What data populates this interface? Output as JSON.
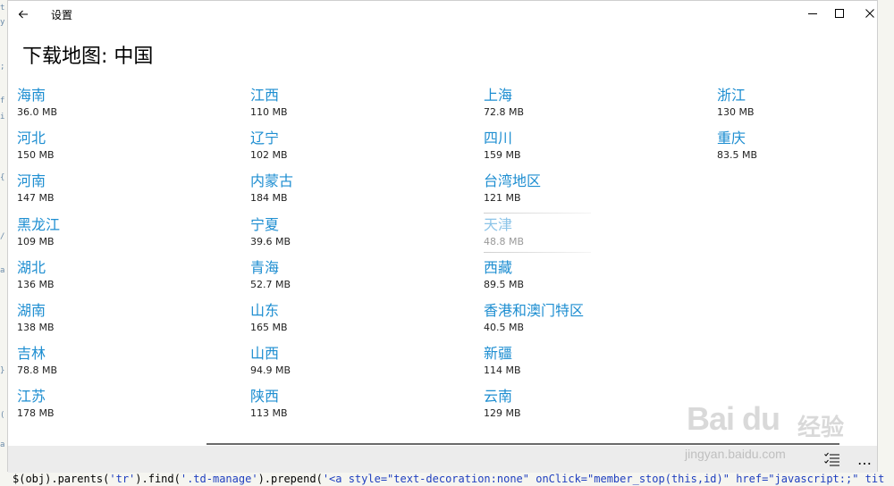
{
  "window": {
    "title": "设置"
  },
  "page": {
    "title": "下载地图: 中国"
  },
  "columns": [
    [
      {
        "name": "海南",
        "size": "36.0 MB"
      },
      {
        "name": "河北",
        "size": "150 MB"
      },
      {
        "name": "河南",
        "size": "147 MB"
      },
      {
        "name": "黑龙江",
        "size": "109 MB"
      },
      {
        "name": "湖北",
        "size": "136 MB"
      },
      {
        "name": "湖南",
        "size": "138 MB"
      },
      {
        "name": "吉林",
        "size": "78.8 MB"
      },
      {
        "name": "江苏",
        "size": "178 MB"
      }
    ],
    [
      {
        "name": "江西",
        "size": "110 MB"
      },
      {
        "name": "辽宁",
        "size": "102 MB"
      },
      {
        "name": "内蒙古",
        "size": "184 MB"
      },
      {
        "name": "宁夏",
        "size": "39.6 MB"
      },
      {
        "name": "青海",
        "size": "52.7 MB"
      },
      {
        "name": "山东",
        "size": "165 MB"
      },
      {
        "name": "山西",
        "size": "94.9 MB"
      },
      {
        "name": "陕西",
        "size": "113 MB"
      }
    ],
    [
      {
        "name": "上海",
        "size": "72.8 MB"
      },
      {
        "name": "四川",
        "size": "159 MB"
      },
      {
        "name": "台湾地区",
        "size": "121 MB"
      },
      {
        "name": "天津",
        "size": "48.8 MB",
        "disabled": true
      },
      {
        "name": "西藏",
        "size": "89.5 MB"
      },
      {
        "name": "香港和澳门特区",
        "size": "40.5 MB"
      },
      {
        "name": "新疆",
        "size": "114 MB"
      },
      {
        "name": "云南",
        "size": "129 MB"
      }
    ],
    [
      {
        "name": "浙江",
        "size": "130 MB"
      },
      {
        "name": "重庆",
        "size": "83.5 MB"
      }
    ]
  ],
  "appbar": {
    "more_glyph": "…"
  },
  "background": {
    "bottom_code": [
      {
        "text": "$(obj).parents(",
        "cls": "fn"
      },
      {
        "text": "'tr'",
        "cls": "str"
      },
      {
        "text": ").find(",
        "cls": "fn"
      },
      {
        "text": "'.td-manage'",
        "cls": "str"
      },
      {
        "text": ").prepend(",
        "cls": "fn"
      },
      {
        "text": "'<a style=\"text-decoration:none\" onClick=\"member_stop(this,id)\" href=\"javascript:;\" tit",
        "cls": "str"
      }
    ],
    "left_marks": [
      "t",
      "y",
      ";",
      "f",
      "i",
      "{",
      "/",
      "a",
      "}",
      "(",
      "a"
    ]
  },
  "watermark": {
    "logo": "Bai du",
    "jingyan": "经验",
    "url": "jingyan.baidu.com"
  },
  "colors": {
    "link": "#1e8ed1",
    "disabled_link": "#8cc4e8",
    "appbar": "#ececec"
  }
}
